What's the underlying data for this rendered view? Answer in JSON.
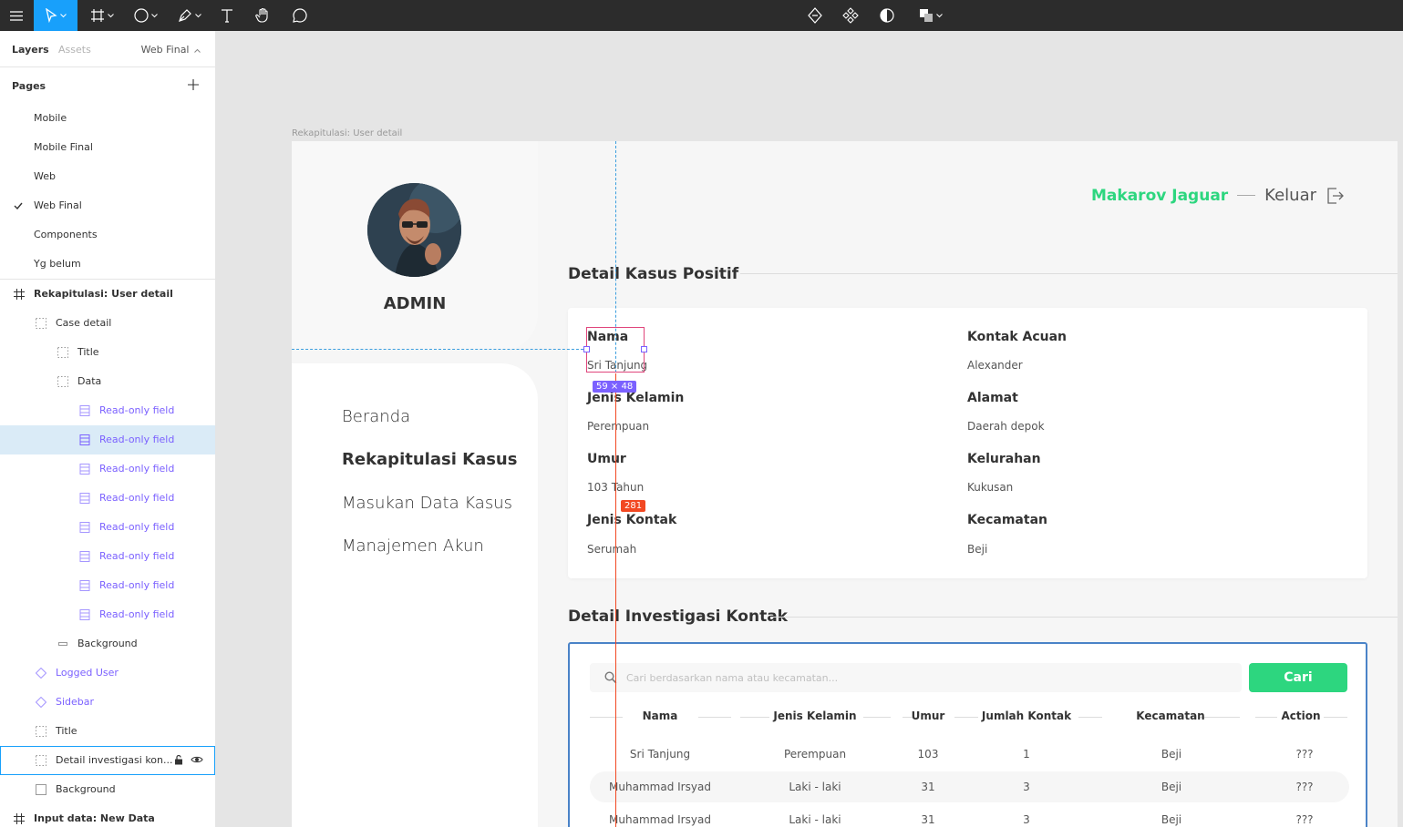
{
  "toolbar": {
    "accent": "#18a0fb"
  },
  "left_panel": {
    "tab_layers": "Layers",
    "tab_assets": "Assets",
    "current_page": "Web Final",
    "pages_title": "Pages",
    "pages": [
      {
        "label": "Mobile",
        "checked": false
      },
      {
        "label": "Mobile Final",
        "checked": false
      },
      {
        "label": "Web",
        "checked": false
      },
      {
        "label": "Web Final",
        "checked": true
      },
      {
        "label": "Components",
        "checked": false
      },
      {
        "label": "Yg belum",
        "checked": false
      }
    ],
    "layers": [
      {
        "label": "Rekapitulasi: User detail",
        "icon": "frame-icon"
      },
      {
        "label": "Case detail",
        "icon": "group-icon"
      },
      {
        "label": "Title",
        "icon": "group-icon"
      },
      {
        "label": "Data",
        "icon": "group-icon"
      },
      {
        "label": "Read-only field",
        "icon": "component-instance-icon"
      },
      {
        "label": "Read-only field",
        "icon": "component-instance-icon",
        "selected": true
      },
      {
        "label": "Read-only field",
        "icon": "component-instance-icon"
      },
      {
        "label": "Read-only field",
        "icon": "component-instance-icon"
      },
      {
        "label": "Read-only field",
        "icon": "component-instance-icon"
      },
      {
        "label": "Read-only field",
        "icon": "component-instance-icon"
      },
      {
        "label": "Read-only field",
        "icon": "component-instance-icon"
      },
      {
        "label": "Read-only field",
        "icon": "component-instance-icon"
      },
      {
        "label": "Background",
        "icon": "rectangle-icon"
      },
      {
        "label": "Logged User",
        "icon": "component-icon"
      },
      {
        "label": "Sidebar",
        "icon": "component-icon"
      },
      {
        "label": "Title",
        "icon": "group-icon"
      },
      {
        "label": "Detail investigasi kon...",
        "icon": "group-icon",
        "hovered": true
      },
      {
        "label": "Background",
        "icon": "rectangle-icon"
      },
      {
        "label": "Input data: New Data",
        "icon": "frame-icon"
      }
    ]
  },
  "canvas": {
    "frame_label": "Rekapitulasi: User detail",
    "admin_label": "ADMIN",
    "nav": [
      "Beranda",
      "Rekapitulasi Kasus",
      "Masukan Data Kasus",
      "Manajemen Akun"
    ],
    "user_name": "Makarov Jaguar",
    "logout_label": "Keluar",
    "case_title": "Detail Kasus Positif",
    "fields": [
      {
        "label": "Nama",
        "value": "Sri Tanjung"
      },
      {
        "label": "Jenis Kelamin",
        "value": "Perempuan"
      },
      {
        "label": "Umur",
        "value": "103 Tahun"
      },
      {
        "label": "Jenis Kontak",
        "value": "Serumah"
      },
      {
        "label": "Kontak Acuan",
        "value": "Alexander"
      },
      {
        "label": "Alamat",
        "value": "Daerah depok"
      },
      {
        "label": "Kelurahan",
        "value": "Kukusan"
      },
      {
        "label": "Kecamatan",
        "value": "Beji"
      }
    ],
    "invest_title": "Detail Investigasi Kontak",
    "search_placeholder": "Cari berdasarkan nama atau kecamatan...",
    "search_button": "Cari",
    "table": {
      "headers": [
        "Nama",
        "Jenis Kelamin",
        "Umur",
        "Jumlah Kontak",
        "Kecamatan",
        "Action"
      ],
      "rows": [
        [
          "Sri Tanjung",
          "Perempuan",
          "103",
          "1",
          "Beji",
          "???"
        ],
        [
          "Muhammad Irsyad",
          "Laki - laki",
          "31",
          "3",
          "Beji",
          "???"
        ],
        [
          "Muhammad Irsyad",
          "Laki - laki",
          "31",
          "3",
          "Beji",
          "???"
        ]
      ]
    },
    "selection_size": "59 × 48",
    "measure_value": "281",
    "colors": {
      "brand_green": "#2dd67f",
      "selection_purple": "#7b61ff",
      "measure_red": "#f24822"
    }
  }
}
